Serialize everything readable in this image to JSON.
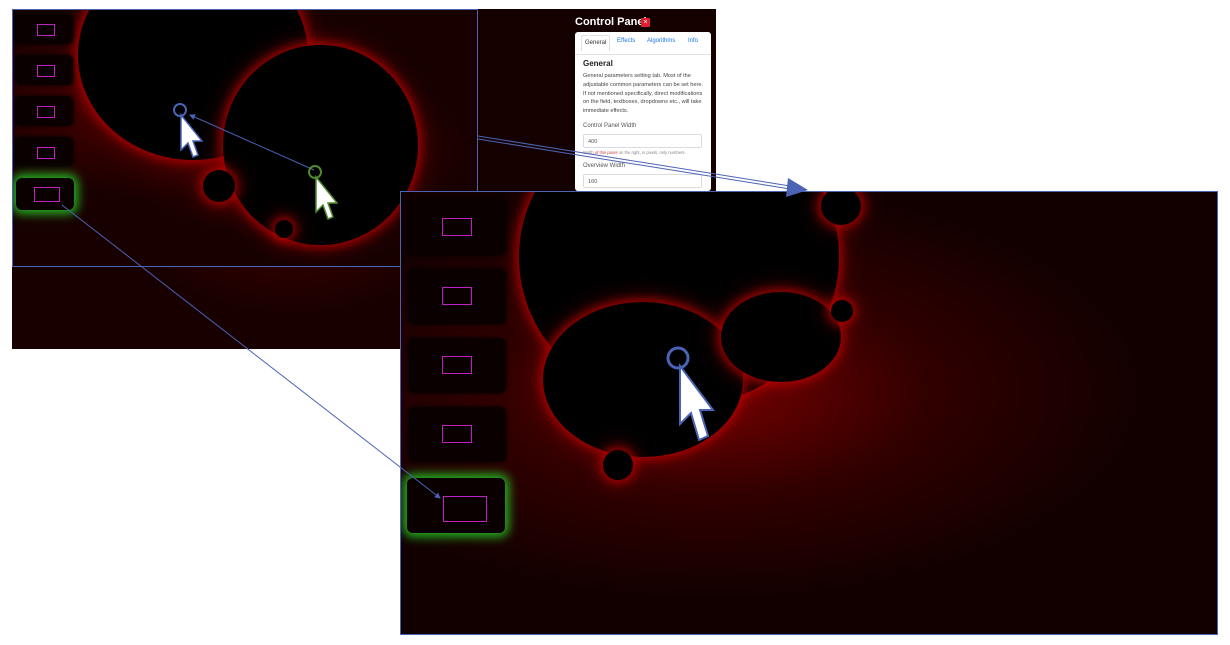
{
  "control_panel": {
    "title": "Control Panel",
    "close_glyph": "×",
    "tabs": [
      {
        "label": "General",
        "active": true
      },
      {
        "label": "Effects",
        "active": false
      },
      {
        "label": "Algorithms",
        "active": false
      },
      {
        "label": "Info",
        "active": false
      }
    ],
    "section_title": "General",
    "description": "General parameters setting tab. Most of the adjustable common parameters can be set here. If not mentioned specifically, direct modifications on the field, textboxes, dropdowns etc., will take immediate effects.",
    "fields": [
      {
        "label": "Control Panel Width",
        "value": "400"
      },
      {
        "label": "Overview Width",
        "value": "160"
      }
    ],
    "hint": {
      "prefix": "Width",
      "red": "of this panel",
      "suffix": " on the right, in pixels, only numbers."
    }
  },
  "thumbnails": {
    "count": 5,
    "active_index": 4
  },
  "colors": {
    "fractal_red": "#d00000",
    "thumbnail_highlight": "#28d228",
    "thumbnail_rect": "#c020c0",
    "arrow_line": "#4a63b5",
    "panel_link": "#1a73e8",
    "close_button": "#e02030"
  },
  "icons": [
    "cursor-arrow-icon",
    "close-icon",
    "target-circle-icon"
  ]
}
